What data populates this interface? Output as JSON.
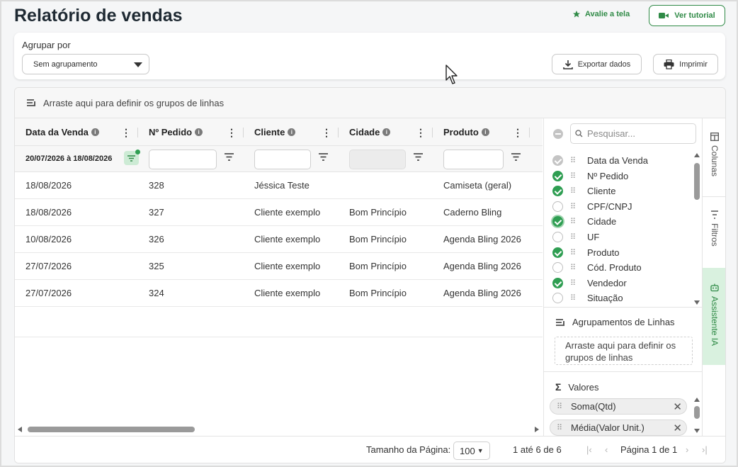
{
  "page": {
    "title": "Relatório de vendas"
  },
  "top_actions": {
    "rate": "Avalie a tela",
    "tutorial": "Ver tutorial"
  },
  "grouping": {
    "label": "Agrupar por",
    "selected": "Sem agrupamento"
  },
  "toolbar": {
    "export": "Exportar dados",
    "print": "Imprimir"
  },
  "grid": {
    "drop_hint": "Arraste aqui para definir os grupos de linhas",
    "columns": [
      "Data da Venda",
      "Nº Pedido",
      "Cliente",
      "Cidade",
      "Produto"
    ],
    "date_filter": "20/07/2026 à 18/08/2026",
    "rows": [
      {
        "data": "18/08/2026",
        "pedido": "328",
        "cliente": "Jéssica Teste",
        "cidade": "",
        "produto": "Camiseta (geral)"
      },
      {
        "data": "18/08/2026",
        "pedido": "327",
        "cliente": "Cliente exemplo",
        "cidade": "Bom Princípio",
        "produto": "Caderno Bling"
      },
      {
        "data": "10/08/2026",
        "pedido": "326",
        "cliente": "Cliente exemplo",
        "cidade": "Bom Princípio",
        "produto": "Agenda Bling 2026"
      },
      {
        "data": "27/07/2026",
        "pedido": "325",
        "cliente": "Cliente exemplo",
        "cidade": "Bom Princípio",
        "produto": "Agenda Bling 2026"
      },
      {
        "data": "27/07/2026",
        "pedido": "324",
        "cliente": "Cliente exemplo",
        "cidade": "Bom Princípio",
        "produto": "Agenda Bling 2026"
      }
    ]
  },
  "footer": {
    "page_size_label": "Tamanho da Página:",
    "page_size": "100",
    "range": "1 até 6 de 6",
    "page_info": "Página 1 de 1"
  },
  "panel": {
    "search_placeholder": "Pesquisar...",
    "columns": [
      {
        "label": "Data da Venda",
        "state": "disabled"
      },
      {
        "label": "Nº Pedido",
        "state": "checked"
      },
      {
        "label": "Cliente",
        "state": "checked"
      },
      {
        "label": "CPF/CNPJ",
        "state": "unchecked"
      },
      {
        "label": "Cidade",
        "state": "checked"
      },
      {
        "label": "UF",
        "state": "unchecked"
      },
      {
        "label": "Produto",
        "state": "checked"
      },
      {
        "label": "Cód. Produto",
        "state": "unchecked"
      },
      {
        "label": "Vendedor",
        "state": "checked"
      },
      {
        "label": "Situação",
        "state": "unchecked"
      }
    ],
    "row_groups_title": "Agrupamentos de Linhas",
    "row_groups_hint_1": "Arraste aqui para definir os",
    "row_groups_hint_2": "grupos de linhas",
    "values_title": "Valores",
    "values": [
      "Soma(Qtd)",
      "Média(Valor Unit.)"
    ]
  },
  "side_tabs": [
    "Colunas",
    "Filtros",
    "Assistente IA"
  ],
  "colors": {
    "accent": "#2f8a46",
    "check": "#2f9e52",
    "active_tab_bg": "#d9f1df"
  }
}
